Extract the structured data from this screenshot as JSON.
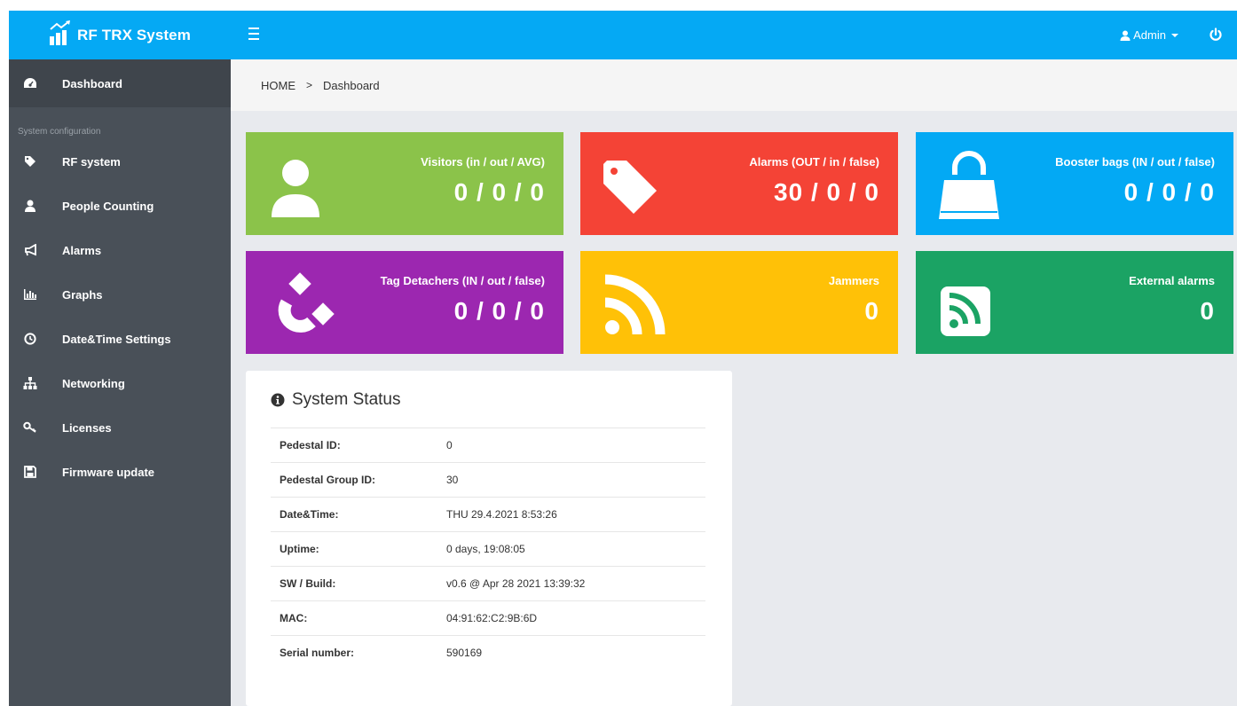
{
  "app": {
    "title": "RF TRX System"
  },
  "topbar": {
    "user_label": "Admin"
  },
  "sidebar": {
    "section_header": "System configuration",
    "items": [
      {
        "label": "Dashboard",
        "icon": "dashboard-icon"
      },
      {
        "label": "RF system",
        "icon": "tag-icon"
      },
      {
        "label": "People Counting",
        "icon": "user-icon"
      },
      {
        "label": "Alarms",
        "icon": "bullhorn-icon"
      },
      {
        "label": "Graphs",
        "icon": "bar-chart-icon"
      },
      {
        "label": "Date&Time Settings",
        "icon": "clock-icon"
      },
      {
        "label": "Networking",
        "icon": "sitemap-icon"
      },
      {
        "label": "Licenses",
        "icon": "key-icon"
      },
      {
        "label": "Firmware update",
        "icon": "save-icon"
      }
    ]
  },
  "breadcrumb": {
    "home": "HOME",
    "separator": ">",
    "current": "Dashboard"
  },
  "cards": [
    {
      "title": "Visitors (in / out / AVG)",
      "value": "0 / 0 / 0",
      "color": "#8bc34a",
      "icon": "user-icon"
    },
    {
      "title": "Alarms (OUT / in / false)",
      "value": "30 / 0 / 0",
      "color": "#f44336",
      "icon": "tag-icon"
    },
    {
      "title": "Booster bags (IN / out / false)",
      "value": "0 / 0 / 0",
      "color": "#03a9f4",
      "icon": "shopping-bag-icon"
    },
    {
      "title": "Tag Detachers (IN / out / false)",
      "value": "0 / 0 / 0",
      "color": "#9c27b0",
      "icon": "magnet-icon"
    },
    {
      "title": "Jammers",
      "value": "0",
      "color": "#ffc107",
      "icon": "rss-icon"
    },
    {
      "title": "External alarms",
      "value": "0",
      "color": "#1ba364",
      "icon": "rss-square-icon"
    }
  ],
  "status": {
    "title": "System Status",
    "rows": [
      {
        "label": "Pedestal ID:",
        "value": "0"
      },
      {
        "label": "Pedestal Group ID:",
        "value": "30"
      },
      {
        "label": "Date&Time:",
        "value": "THU 29.4.2021 8:53:26"
      },
      {
        "label": "Uptime:",
        "value": "0 days, 19:08:05"
      },
      {
        "label": "SW / Build:",
        "value": "v0.6 @ Apr 28 2021 13:39:32"
      },
      {
        "label": "MAC:",
        "value": "04:91:62:C2:9B:6D"
      },
      {
        "label": "Serial number:",
        "value": "590169"
      }
    ]
  }
}
